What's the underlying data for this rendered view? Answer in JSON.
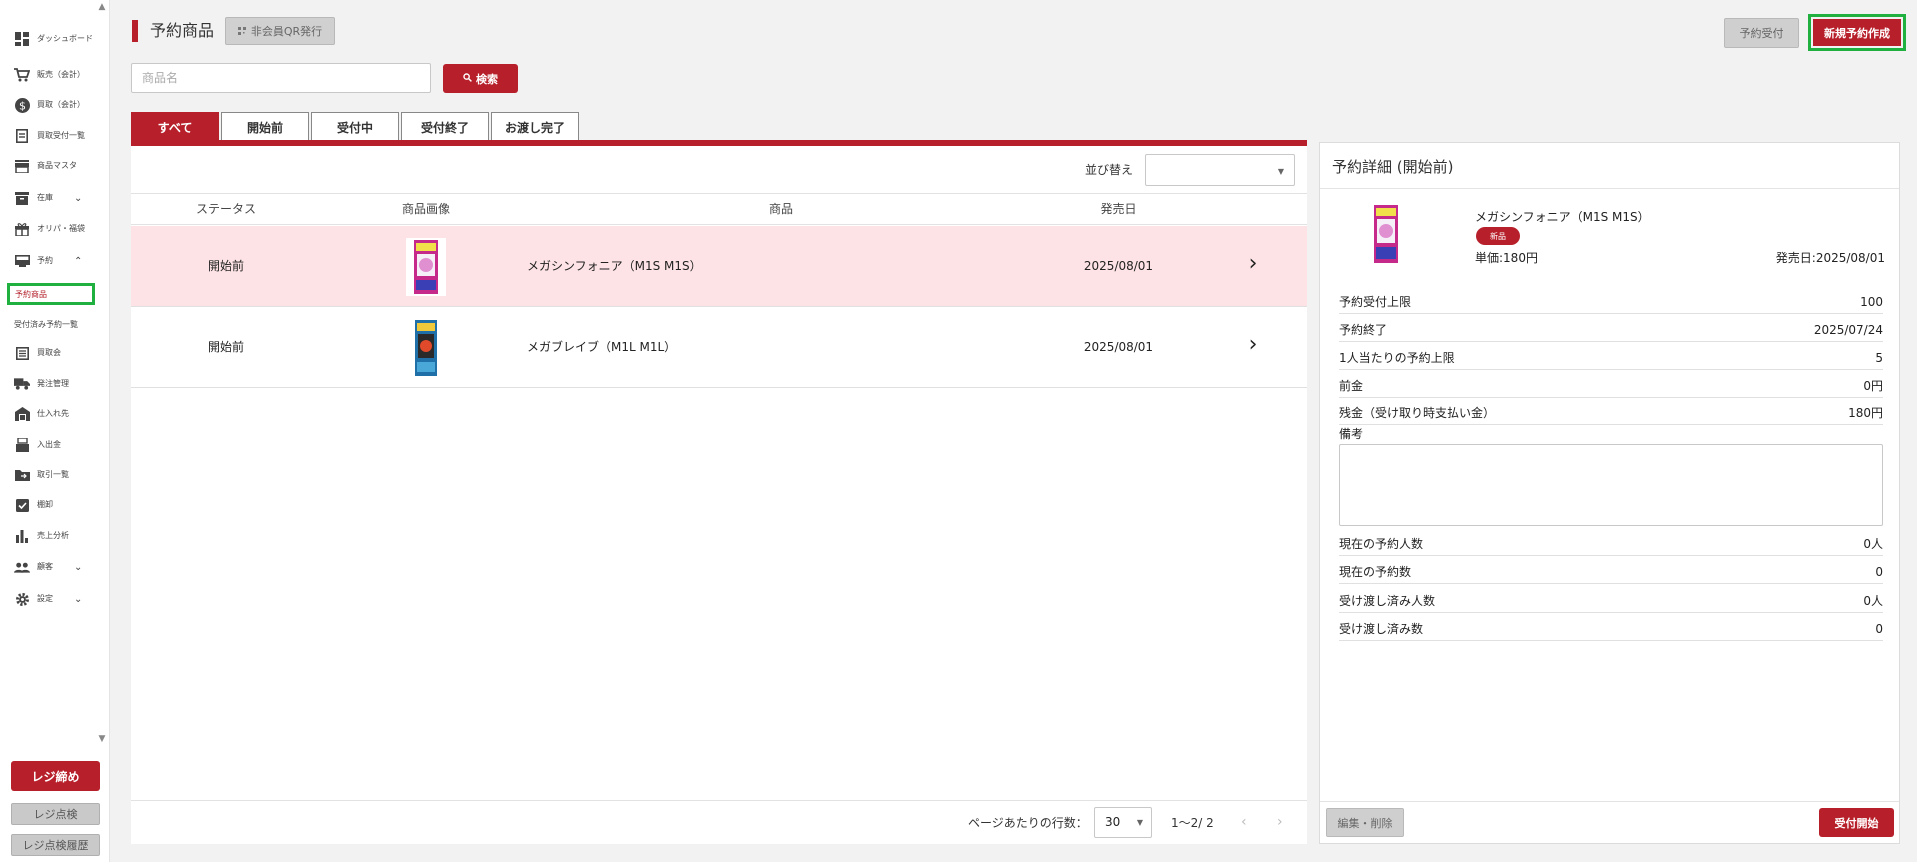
{
  "sidebar": {
    "items": [
      {
        "label": "ダッシュボード",
        "icon": "dashboard-icon"
      },
      {
        "label": "販売（会計）",
        "icon": "cart-icon"
      },
      {
        "label": "買取（会計）",
        "icon": "dollar-icon"
      },
      {
        "label": "買取受付一覧",
        "icon": "receipt-icon"
      },
      {
        "label": "商品マスタ",
        "icon": "store-icon"
      },
      {
        "label": "在庫",
        "icon": "archive-icon"
      },
      {
        "label": "オリパ・福袋",
        "icon": "gift-icon"
      },
      {
        "label": "予約",
        "icon": "monitor-icon"
      },
      {
        "label": "買取会",
        "icon": "list-icon"
      },
      {
        "label": "発注管理",
        "icon": "truck-icon"
      },
      {
        "label": "仕入れ先",
        "icon": "warehouse-icon"
      },
      {
        "label": "入出金",
        "icon": "register-icon"
      },
      {
        "label": "取引一覧",
        "icon": "folder-icon"
      },
      {
        "label": "棚卸",
        "icon": "checkbox-icon"
      },
      {
        "label": "売上分析",
        "icon": "bar-chart-icon"
      },
      {
        "label": "顧客",
        "icon": "people-icon"
      },
      {
        "label": "設定",
        "icon": "gear-icon"
      }
    ],
    "sub_items": {
      "reservation_products": "予約商品",
      "accepted_reservations": "受付済み予約一覧"
    },
    "reji_close": "レジ締め",
    "reji_check": "レジ点検",
    "reji_check_history": "レジ点検履歴"
  },
  "header": {
    "title": "予約商品",
    "qr_button": "非会員QR発行",
    "reserve_button": "予約受付",
    "new_button": "新規予約作成"
  },
  "search": {
    "placeholder": "商品名",
    "value": "",
    "button": "検索"
  },
  "tabs": [
    {
      "label": "すべて",
      "active": true
    },
    {
      "label": "開始前",
      "active": false
    },
    {
      "label": "受付中",
      "active": false
    },
    {
      "label": "受付終了",
      "active": false
    },
    {
      "label": "お渡し完了",
      "active": false
    }
  ],
  "table": {
    "sort_label": "並び替え",
    "sort_value": "",
    "headers": {
      "status": "ステータス",
      "image": "商品画像",
      "product": "商品",
      "release": "発売日"
    },
    "rows": [
      {
        "status": "開始前",
        "product": "メガシンフォニア（M1S M1S）",
        "release": "2025/08/01",
        "selected": true
      },
      {
        "status": "開始前",
        "product": "メガブレイブ（M1L M1L）",
        "release": "2025/08/01",
        "selected": false
      }
    ]
  },
  "pagination": {
    "rows_per_page_label": "ページあたりの行数：",
    "rows_per_page": "30",
    "range": "1〜2/ 2"
  },
  "detail": {
    "title": "予約詳細 (開始前)",
    "product_name": "メガシンフォニア（M1S M1S）",
    "badge": "新品",
    "unit_price": "単価:180円",
    "release_date": "発売日:2025/08/01",
    "fields_top": [
      {
        "key": "予約受付上限",
        "value": "100"
      },
      {
        "key": "予約終了",
        "value": "2025/07/24"
      },
      {
        "key": "1人当たりの予約上限",
        "value": "5"
      },
      {
        "key": "前金",
        "value": "0円"
      },
      {
        "key": "残金（受け取り時支払い金）",
        "value": "180円"
      }
    ],
    "notes_label": "備考",
    "notes_value": "",
    "fields_bottom": [
      {
        "key": "現在の予約人数",
        "value": "0人"
      },
      {
        "key": "現在の予約数",
        "value": "0"
      },
      {
        "key": "受け渡し済み人数",
        "value": "0人"
      },
      {
        "key": "受け渡し済み数",
        "value": "0"
      }
    ],
    "edit_button": "編集・削除",
    "start_button": "受付開始"
  },
  "colors": {
    "accent": "#b7202b",
    "highlight_row": "#fde3e5",
    "annotation_green": "#20b040"
  }
}
